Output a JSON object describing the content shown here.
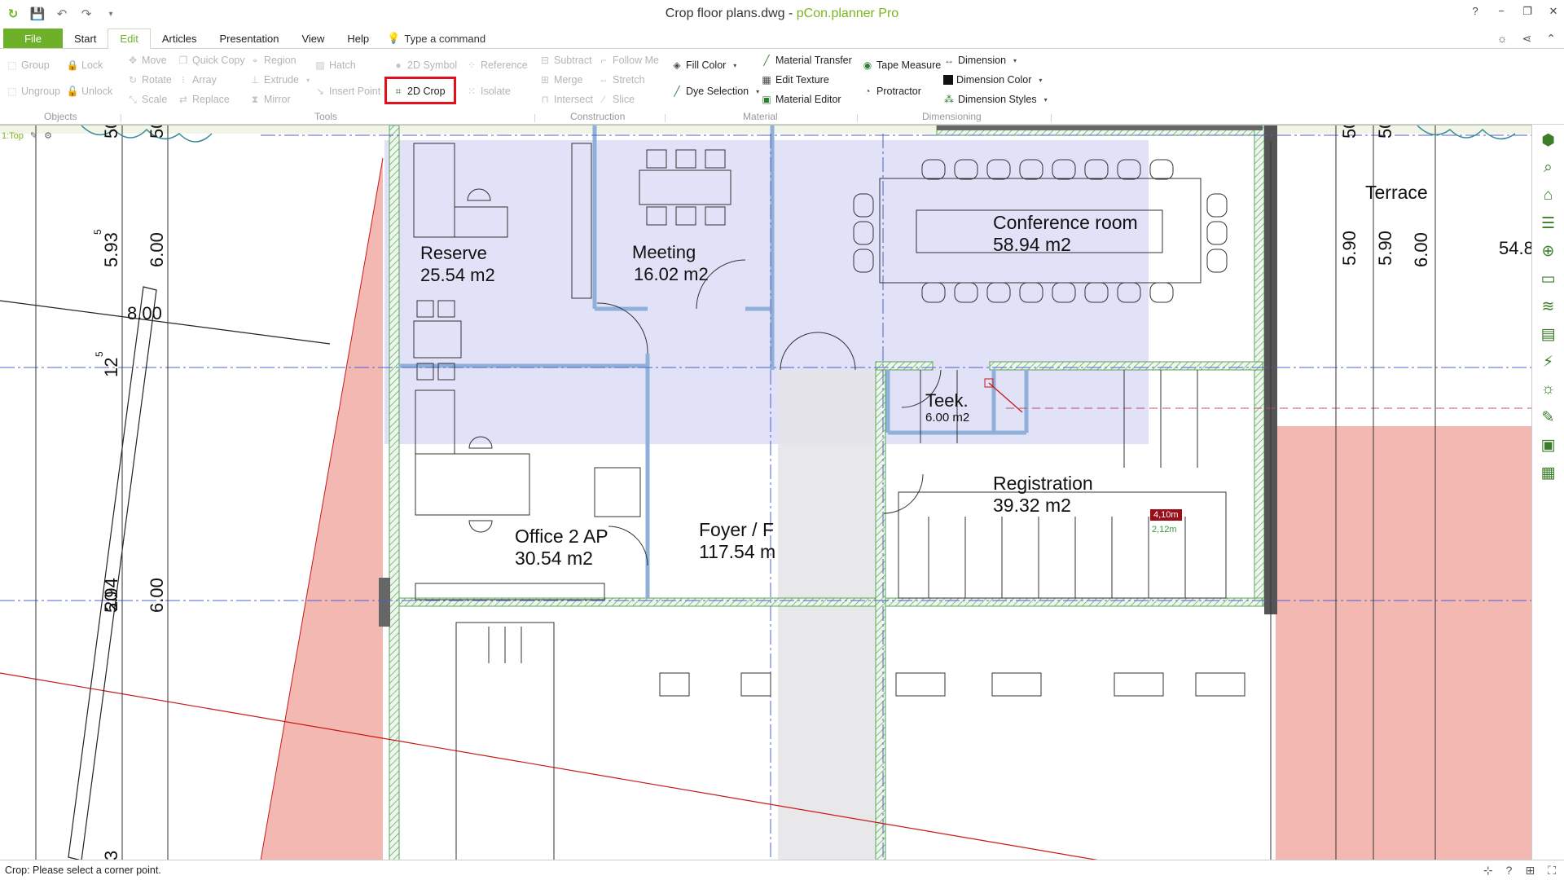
{
  "window": {
    "file_name": "Crop floor plans.dwg",
    "separator": " - ",
    "app_name": "pCon.planner Pro",
    "controls": [
      "?",
      "−",
      "❐",
      "✕"
    ]
  },
  "quick_access": [
    "save-icon",
    "undo-icon",
    "redo-icon",
    "customize-icon"
  ],
  "tabs": {
    "file": "File",
    "items": [
      "Start",
      "Edit",
      "Articles",
      "Presentation",
      "View",
      "Help"
    ],
    "active": "Edit",
    "command": "Type a command"
  },
  "ribbon": {
    "objects": {
      "label": "Objects",
      "group": "Group",
      "lock": "Lock",
      "ungroup": "Ungroup",
      "unlock": "Unlock"
    },
    "tools": {
      "label": "Tools",
      "move": "Move",
      "quick_copy": "Quick Copy",
      "region": "Region",
      "hatch": "Hatch",
      "rotate": "Rotate",
      "array": "Array",
      "extrude": "Extrude",
      "scale": "Scale",
      "replace": "Replace",
      "mirror": "Mirror",
      "insert_point": "Insert Point",
      "symbol_2d": "2D Symbol",
      "crop_2d": "2D Crop",
      "reference": "Reference",
      "isolate": "Isolate"
    },
    "construction": {
      "label": "Construction",
      "subtract": "Subtract",
      "follow_me": "Follow Me",
      "merge": "Merge",
      "stretch": "Stretch",
      "intersect": "Intersect",
      "slice": "Slice"
    },
    "material": {
      "label": "Material",
      "fill_color": "Fill Color",
      "dye_selection": "Dye Selection",
      "material_transfer": "Material Transfer",
      "edit_texture": "Edit Texture",
      "material_editor": "Material Editor"
    },
    "dimensioning": {
      "label": "Dimensioning",
      "tape_measure": "Tape Measure",
      "protractor": "Protractor",
      "dimension": "Dimension",
      "dimension_color": "Dimension Color",
      "dimension_styles": "Dimension Styles"
    }
  },
  "viewport": {
    "view_label": "1:Top",
    "rooms": [
      {
        "name": "Reserve",
        "area": "25.54 m2"
      },
      {
        "name": "Meeting",
        "area": "16.02 m2"
      },
      {
        "name": "Conference room",
        "area": "58.94 m2"
      },
      {
        "name": "Teek.",
        "area": "6.00 m2"
      },
      {
        "name": "Registration",
        "area": "39.32 m2"
      },
      {
        "name": "Office 2 AP",
        "area": "30.54 m2"
      },
      {
        "name": "Foyer / F",
        "area": "117.54 m"
      },
      {
        "name": "Terrace",
        "area": ""
      }
    ],
    "dims_left": [
      "50",
      "50",
      "5.93",
      "5",
      "6.00",
      "8.00",
      "12",
      "5",
      "5.94",
      "6.00",
      "20",
      "3"
    ],
    "dims_right": [
      "50",
      "50",
      "5.90",
      "5.90",
      "6.00",
      "54.8"
    ],
    "live_dim_primary": "4,10m",
    "live_dim_secondary": "2,12m",
    "colors": {
      "crop_region": "#dcdcf7",
      "red_area": "#f4b8b2",
      "wall": "#9ab5d6",
      "hatch": "#5aa35a",
      "axis_line": "#5060c8"
    }
  },
  "right_toolbar": [
    "cube-icon",
    "catalog-search-icon",
    "furniture-icon",
    "list-icon",
    "globe-search-icon",
    "box-icon",
    "layers-icon",
    "material-icon",
    "lighting-icon",
    "sun-icon",
    "brush-icon",
    "image-icon",
    "properties-icon"
  ],
  "status": {
    "text": "Crop: Please select a corner point."
  }
}
